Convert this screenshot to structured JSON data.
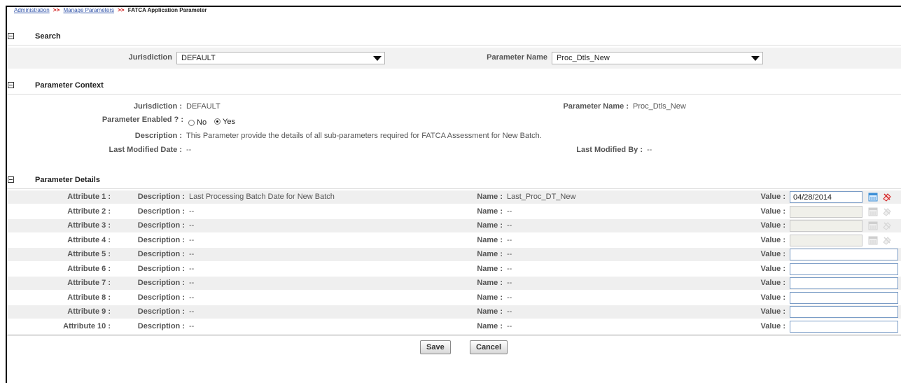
{
  "breadcrumb": {
    "items": [
      "Administration",
      "Manage Parameters"
    ],
    "separator": ">>",
    "current": "FATCA Application Parameter"
  },
  "search": {
    "title": "Search",
    "jurisdiction_label": "Jurisdiction",
    "jurisdiction_value": "DEFAULT",
    "parameter_name_label": "Parameter Name",
    "parameter_name_value": "Proc_Dtls_New"
  },
  "context": {
    "title": "Parameter Context",
    "jurisdiction_label": "Jurisdiction :",
    "jurisdiction_value": "DEFAULT",
    "parameter_name_label": "Parameter Name :",
    "parameter_name_value": "Proc_Dtls_New",
    "enabled_label": "Parameter Enabled ? :",
    "enabled_no": "No",
    "enabled_yes": "Yes",
    "enabled_selected": "Yes",
    "description_label": "Description :",
    "description_value": "This Parameter provide the details of all sub-parameters required for FATCA Assessment for New Batch.",
    "modified_date_label": "Last Modified Date :",
    "modified_date_value": "--",
    "modified_by_label": "Last Modified By :",
    "modified_by_value": "--"
  },
  "details": {
    "title": "Parameter Details",
    "description_label": "Description :",
    "name_label": "Name :",
    "value_label": "Value :",
    "rows": [
      {
        "attribute": "Attribute 1 :",
        "description": "Last Processing Batch Date for New Batch",
        "name": "Last_Proc_DT_New",
        "value": "04/28/2014"
      },
      {
        "attribute": "Attribute 2 :",
        "description": "--",
        "name": "--",
        "value": ""
      },
      {
        "attribute": "Attribute 3 :",
        "description": "--",
        "name": "--",
        "value": ""
      },
      {
        "attribute": "Attribute 4 :",
        "description": "--",
        "name": "--",
        "value": ""
      },
      {
        "attribute": "Attribute 5 :",
        "description": "--",
        "name": "--",
        "value": ""
      },
      {
        "attribute": "Attribute 6 :",
        "description": "--",
        "name": "--",
        "value": ""
      },
      {
        "attribute": "Attribute 7 :",
        "description": "--",
        "name": "--",
        "value": ""
      },
      {
        "attribute": "Attribute 8 :",
        "description": "--",
        "name": "--",
        "value": ""
      },
      {
        "attribute": "Attribute 9 :",
        "description": "--",
        "name": "--",
        "value": ""
      },
      {
        "attribute": "Attribute 10 :",
        "description": "--",
        "name": "--",
        "value": ""
      }
    ]
  },
  "buttons": {
    "save": "Save",
    "cancel": "Cancel"
  },
  "icons": {
    "collapse": "collapse-icon",
    "calendar": "calendar-icon",
    "clear": "clear-date-icon"
  },
  "colors": {
    "link": "#3355aa",
    "separator": "#c00000",
    "band": "#f2f2f2",
    "field_border": "#7a9cc6"
  }
}
